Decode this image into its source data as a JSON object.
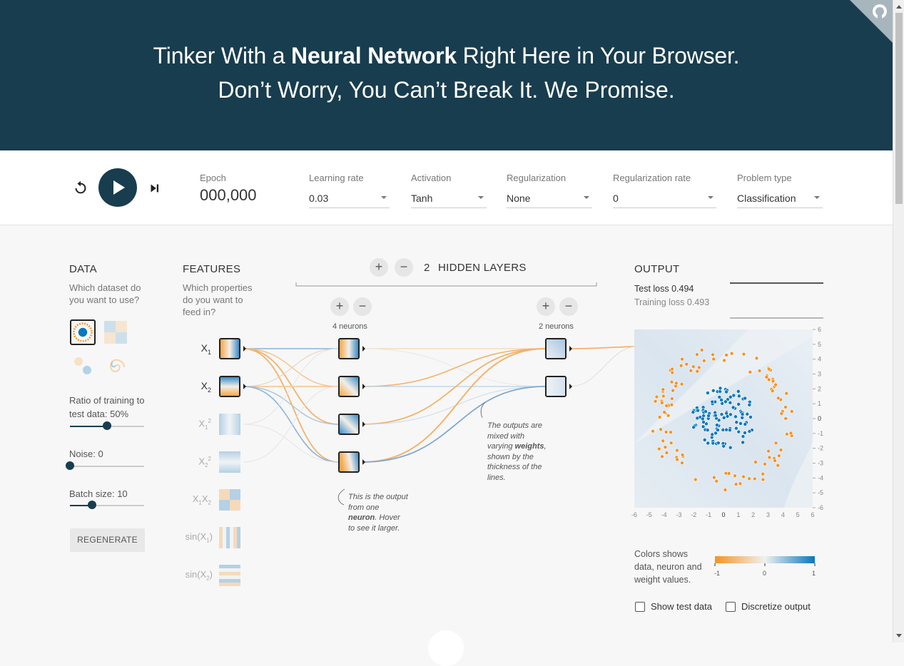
{
  "hero": {
    "line1_pre": "Tinker With a ",
    "line1_bold": "Neural Network",
    "line1_post": " Right Here in Your Browser.",
    "line2": "Don’t Worry, You Can’t Break It. We Promise."
  },
  "controls": {
    "epoch_label": "Epoch",
    "epoch_value": "000,000",
    "learning_rate": {
      "label": "Learning rate",
      "value": "0.03"
    },
    "activation": {
      "label": "Activation",
      "value": "Tanh"
    },
    "regularization": {
      "label": "Regularization",
      "value": "None"
    },
    "regularization_rate": {
      "label": "Regularization rate",
      "value": "0"
    },
    "problem_type": {
      "label": "Problem type",
      "value": "Classification"
    }
  },
  "data_panel": {
    "title": "DATA",
    "subtitle_1": "Which dataset do",
    "subtitle_2": "you want to use?",
    "ratio_label_1": "Ratio of training to",
    "ratio_label_2": "test data:  50%",
    "ratio_value": 0.5,
    "noise_label": "Noise:  0",
    "noise_value": 0,
    "batch_label": "Batch size:  10",
    "batch_value": 0.3,
    "regenerate": "REGENERATE"
  },
  "features_panel": {
    "title": "FEATURES",
    "subtitle_1": "Which properties",
    "subtitle_2": "do you want to",
    "subtitle_3": "feed in?"
  },
  "network": {
    "layer_count": "2",
    "layers_label": "HIDDEN LAYERS",
    "layer1_label": "4 neurons",
    "layer2_label": "2 neurons",
    "note1": [
      "This is the output",
      "from one",
      "neuron",
      ". Hover",
      "to see it larger."
    ],
    "note2": [
      "The outputs are",
      "mixed with",
      "varying ",
      "weights",
      ",",
      "shown by the",
      "thickness of the",
      "lines."
    ]
  },
  "output_panel": {
    "title": "OUTPUT",
    "test_loss": "Test loss 0.494",
    "training_loss": "Training loss 0.493",
    "colors_note_1": "Colors shows",
    "colors_note_2": "data, neuron and",
    "colors_note_3": "weight values.",
    "legend_min": "-1",
    "legend_mid": "0",
    "legend_max": "1",
    "show_test_data": "Show test data",
    "discretize_output": "Discretize output",
    "colors": {
      "orange": "#f59322",
      "blue": "#0877bd",
      "dark": "#183d4e"
    }
  }
}
